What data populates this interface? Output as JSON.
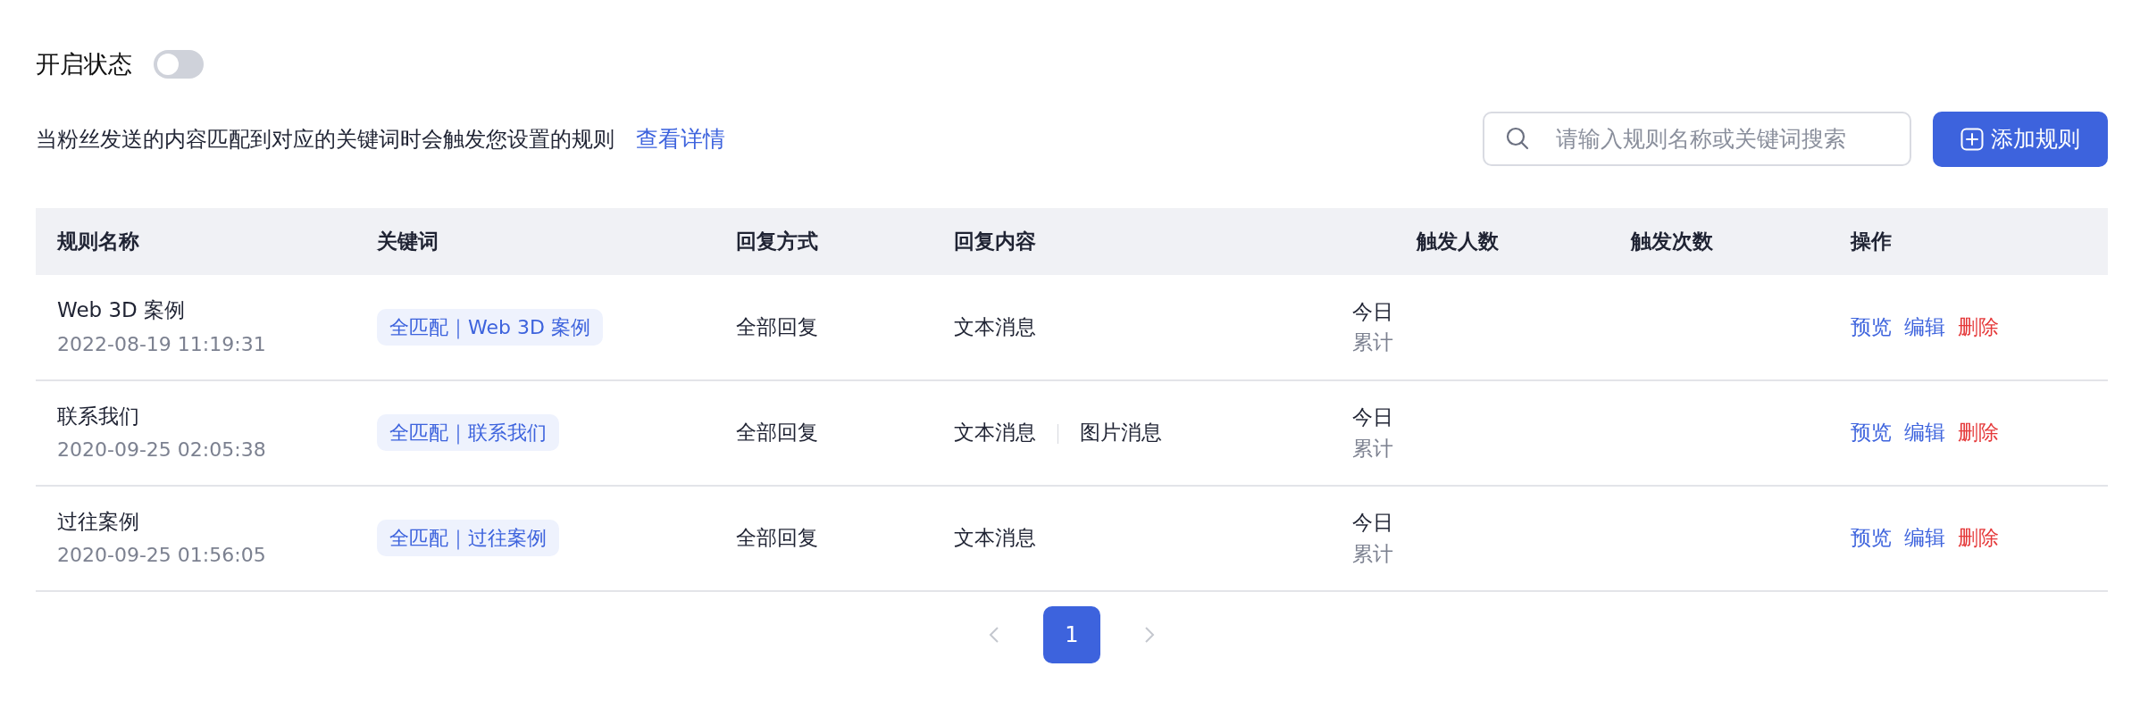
{
  "toggle": {
    "label": "开启状态",
    "on": false
  },
  "description": "当粉丝发送的内容匹配到对应的关键词时会触发您设置的规则",
  "details_link": "查看详情",
  "search": {
    "placeholder": "请输入规则名称或关键词搜索"
  },
  "add_button": "添加规则",
  "table": {
    "columns": [
      "规则名称",
      "关键词",
      "回复方式",
      "回复内容",
      "触发人数",
      "触发次数",
      "操作"
    ],
    "rows": [
      {
        "name": "Web 3D 案例",
        "created": "2022-08-19 11:19:31",
        "keyword": "全匹配｜Web 3D 案例",
        "reply_mode": "全部回复",
        "reply_content": [
          "文本消息"
        ],
        "today_label": "今日",
        "total_label": "累计",
        "actions": [
          {
            "label": "预览",
            "kind": "link"
          },
          {
            "label": "编辑",
            "kind": "link"
          },
          {
            "label": "删除",
            "kind": "danger"
          }
        ]
      },
      {
        "name": "联系我们",
        "created": "2020-09-25 02:05:38",
        "keyword": "全匹配｜联系我们",
        "reply_mode": "全部回复",
        "reply_content": [
          "文本消息",
          "图片消息"
        ],
        "today_label": "今日",
        "total_label": "累计",
        "actions": [
          {
            "label": "预览",
            "kind": "link"
          },
          {
            "label": "编辑",
            "kind": "link"
          },
          {
            "label": "删除",
            "kind": "danger"
          }
        ]
      },
      {
        "name": "过往案例",
        "created": "2020-09-25 01:56:05",
        "keyword": "全匹配｜过往案例",
        "reply_mode": "全部回复",
        "reply_content": [
          "文本消息"
        ],
        "today_label": "今日",
        "total_label": "累计",
        "actions": [
          {
            "label": "预览",
            "kind": "link"
          },
          {
            "label": "编辑",
            "kind": "link"
          },
          {
            "label": "删除",
            "kind": "danger"
          }
        ]
      }
    ]
  },
  "pagination": {
    "prev_disabled": true,
    "next_disabled": true,
    "pages": [
      {
        "label": "1",
        "selected": true
      }
    ]
  }
}
